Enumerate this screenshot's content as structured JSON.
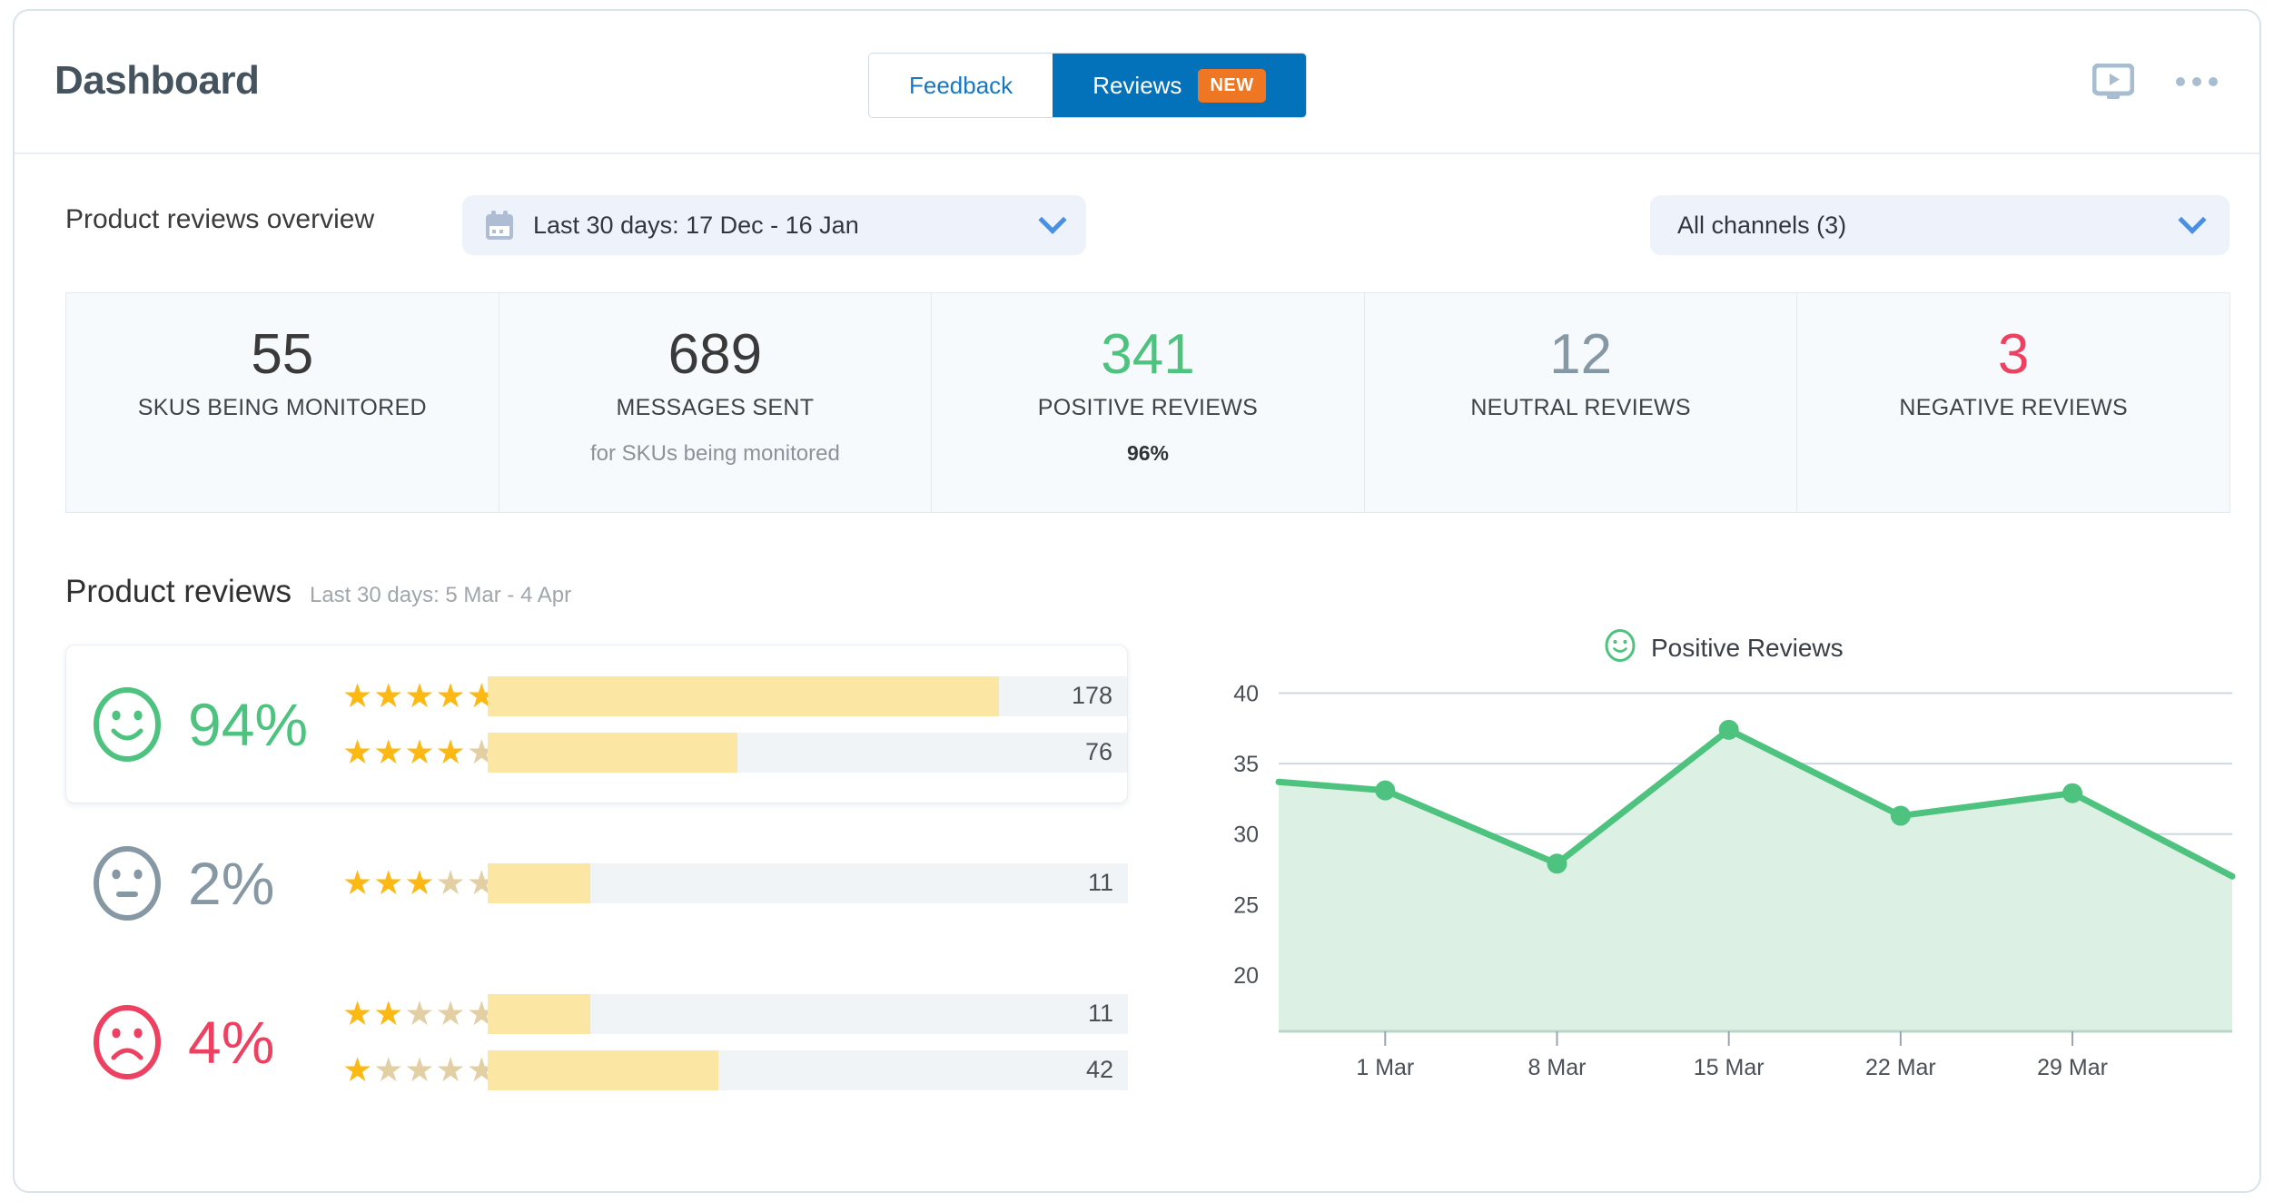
{
  "header": {
    "title": "Dashboard",
    "tabs": [
      {
        "label": "Feedback",
        "active": false
      },
      {
        "label": "Reviews",
        "active": true,
        "badge": "NEW"
      }
    ],
    "icons": {
      "video": "video-play-icon",
      "more": "more-options-icon"
    }
  },
  "overview": {
    "label": "Product reviews overview",
    "date_filter": "Last 30 days: 17 Dec - 16 Jan",
    "channel_filter": "All channels (3)"
  },
  "kpis": [
    {
      "value": "55",
      "label": "SKUS BEING MONITORED",
      "sub": "",
      "tone": "dark"
    },
    {
      "value": "689",
      "label": "MESSAGES SENT",
      "sub": "for SKUs being monitored",
      "tone": "dark"
    },
    {
      "value": "341",
      "label": "POSITIVE REVIEWS",
      "sub": "96%",
      "tone": "pos"
    },
    {
      "value": "12",
      "label": "NEUTRAL REVIEWS",
      "sub": "",
      "tone": "neu"
    },
    {
      "value": "3",
      "label": "NEGATIVE REVIEWS",
      "sub": "",
      "tone": "neg"
    }
  ],
  "product_reviews": {
    "title": "Product reviews",
    "range": "Last 30 days: 5 Mar - 4 Apr",
    "sentiments": [
      {
        "sentiment": "positive",
        "percent": "94%",
        "tone": "pos",
        "highlighted": true,
        "bars": [
          {
            "stars": 5,
            "count": "178",
            "fill_pct": 80
          },
          {
            "stars": 4,
            "count": "76",
            "fill_pct": 39
          }
        ]
      },
      {
        "sentiment": "neutral",
        "percent": "2%",
        "tone": "neu",
        "highlighted": false,
        "bars": [
          {
            "stars": 3,
            "count": "11",
            "fill_pct": 16
          }
        ]
      },
      {
        "sentiment": "negative",
        "percent": "4%",
        "tone": "neg",
        "highlighted": false,
        "bars": [
          {
            "stars": 2,
            "count": "11",
            "fill_pct": 16
          },
          {
            "stars": 1,
            "count": "42",
            "fill_pct": 36
          }
        ]
      }
    ]
  },
  "chart_data": {
    "type": "area",
    "title": "",
    "legend": [
      {
        "label": "Positive Reviews",
        "color": "#4ec27f",
        "icon": "smiley-icon"
      }
    ],
    "legend_position": "top-right",
    "xlabel": "",
    "ylabel": "",
    "x_tick_labels": [
      "1 Mar",
      "8 Mar",
      "15 Mar",
      "22 Mar",
      "29 Mar"
    ],
    "y_ticks": [
      20,
      25,
      30,
      35,
      40
    ],
    "ylim": [
      16,
      41
    ],
    "grid": true,
    "series": [
      {
        "name": "Positive Reviews",
        "color": "#4ec27f",
        "fill_color": "#dcf0e3",
        "x": [
          "1 Mar",
          "8 Mar",
          "15 Mar",
          "22 Mar",
          "29 Mar"
        ],
        "values": [
          33.1,
          27.9,
          37.4,
          31.3,
          32.9
        ],
        "lead_in_value": 33.7,
        "trail_out_value": 27.0
      }
    ]
  }
}
